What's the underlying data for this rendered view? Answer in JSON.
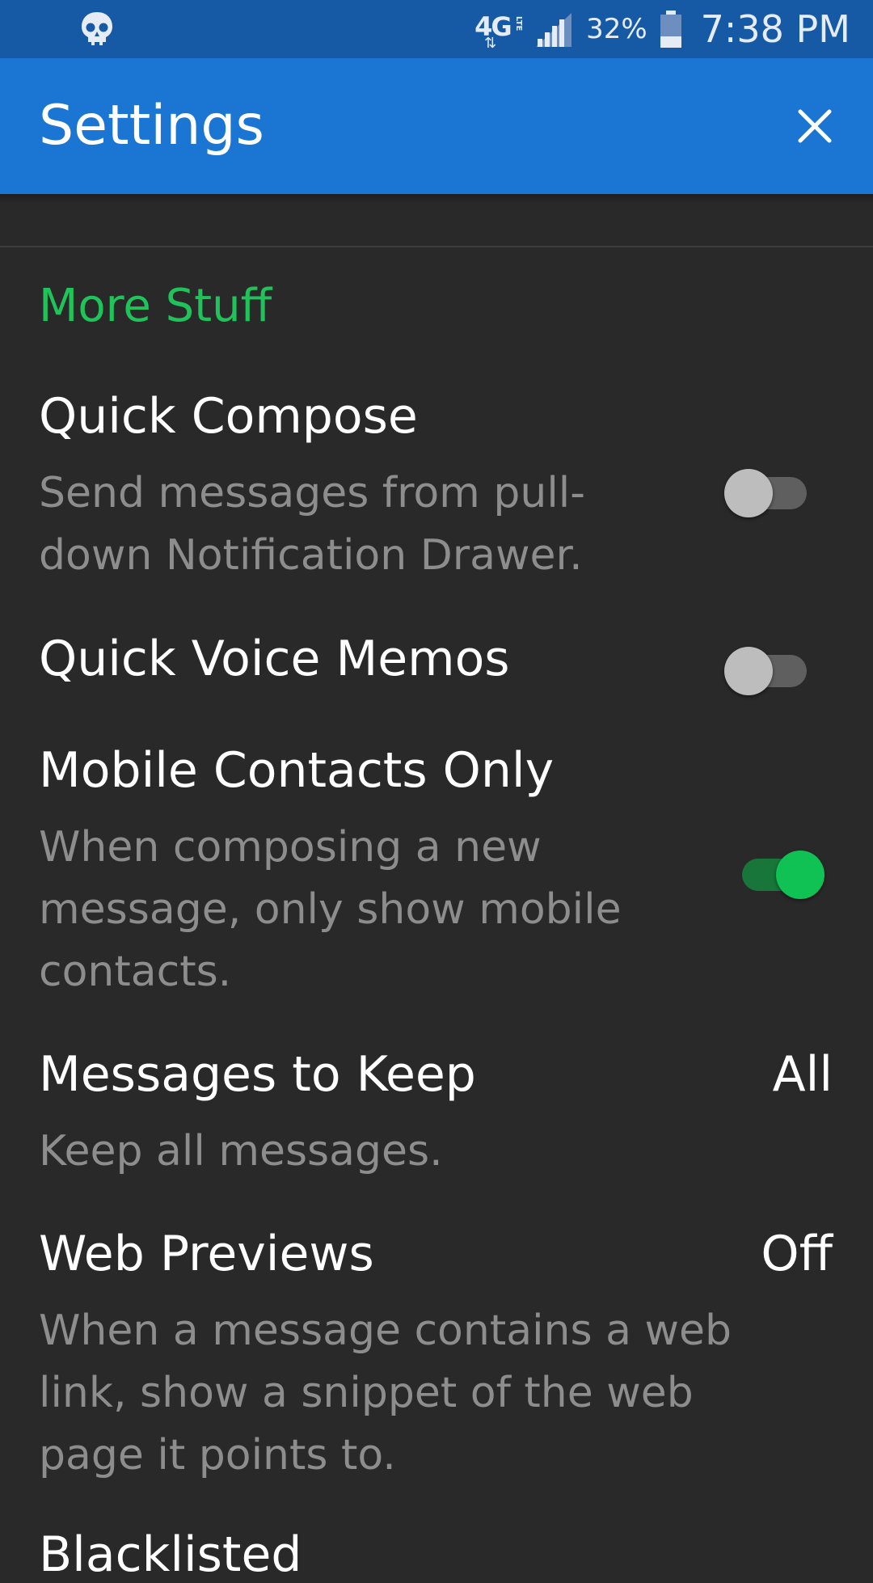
{
  "status_bar": {
    "network_type": "4G",
    "network_sub": "LTE",
    "battery_percent": "32%",
    "time": "7:38 PM"
  },
  "app_bar": {
    "title": "Settings"
  },
  "section": {
    "header": "More Stuff"
  },
  "prefs": {
    "quick_compose": {
      "title": "Quick Compose",
      "summary_line1": "Send messages from pull-",
      "summary_line2": "down Notification Drawer.",
      "enabled": false
    },
    "quick_voice_memos": {
      "title": "Quick Voice Memos",
      "enabled": false
    },
    "mobile_contacts_only": {
      "title": "Mobile Contacts Only",
      "summary_line1": "When composing a new",
      "summary_line2": "message, only show mobile",
      "summary_line3": "contacts.",
      "enabled": true
    },
    "messages_to_keep": {
      "title": "Messages to Keep",
      "value": "All",
      "summary": "Keep all messages."
    },
    "web_previews": {
      "title": "Web Previews",
      "value": "Off",
      "summary_line1": "When a message contains a web",
      "summary_line2": "link, show a snippet of the web",
      "summary_line3": "page it points to."
    },
    "next_item": {
      "title": "Blacklisted"
    }
  },
  "colors": {
    "status_bar": "#165aa6",
    "app_bar": "#1a76d2",
    "background": "#292929",
    "accent_green": "#1fc35a",
    "summary_text": "#8d8d8d"
  },
  "icons": {
    "status_left": "skull-icon",
    "signal": "signal-icon",
    "battery": "battery-icon",
    "close": "close-icon"
  }
}
